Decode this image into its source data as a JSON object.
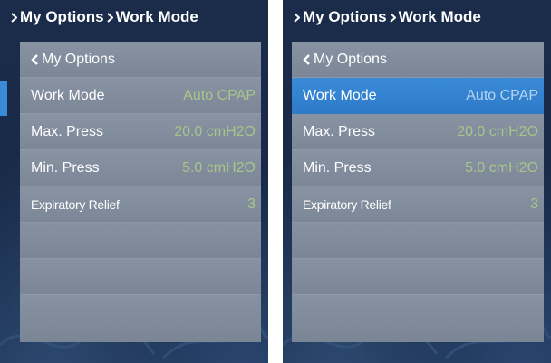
{
  "screens": [
    {
      "breadcrumb": {
        "parent": "My Options",
        "current": "Work Mode"
      },
      "back_label": "My Options",
      "rows": [
        {
          "label": "Work Mode",
          "value": "Auto CPAP"
        },
        {
          "label": "Max. Press",
          "value": "20.0 cmH2O"
        },
        {
          "label": "Min. Press",
          "value": "5.0 cmH2O"
        },
        {
          "label": "Expiratory Relief",
          "value": "3"
        }
      ]
    },
    {
      "breadcrumb": {
        "parent": "My Options",
        "current": "Work Mode"
      },
      "back_label": "My Options",
      "rows": [
        {
          "label": "Work Mode",
          "value": "Auto CPAP"
        },
        {
          "label": "Max. Press",
          "value": "20.0 cmH2O"
        },
        {
          "label": "Min. Press",
          "value": "5.0 cmH2O"
        },
        {
          "label": "Expiratory Relief",
          "value": "3"
        }
      ]
    }
  ],
  "icons": {
    "breadcrumb": "chevron-right-icon",
    "back": "chevron-left-icon"
  },
  "colors": {
    "selection": "#3a8bd8",
    "value_text": "#a8c58a",
    "panel": "#7d8898",
    "background": "#1a2c4a"
  }
}
